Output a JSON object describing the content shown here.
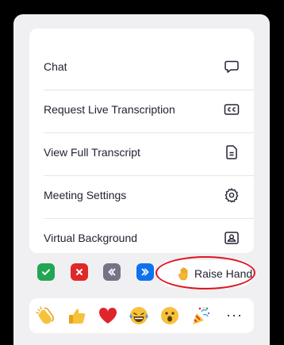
{
  "menu": {
    "items": [
      {
        "label": "Chat",
        "icon": "chat-bubble-icon"
      },
      {
        "label": "Request Live Transcription",
        "icon": "closed-caption-icon"
      },
      {
        "label": "View Full Transcript",
        "icon": "document-icon"
      },
      {
        "label": "Meeting Settings",
        "icon": "gear-icon"
      },
      {
        "label": "Virtual Background",
        "icon": "virtual-background-icon"
      }
    ]
  },
  "status_buttons": [
    {
      "name": "yes",
      "icon": "checkmark-icon",
      "color": "#23a553"
    },
    {
      "name": "no",
      "icon": "x-icon",
      "color": "#e02828"
    },
    {
      "name": "slow-down",
      "icon": "rewind-icon",
      "color": "#747487"
    },
    {
      "name": "speed-up",
      "icon": "fast-forward-icon",
      "color": "#0e72ed"
    }
  ],
  "raise_hand": {
    "label": "Raise Hand",
    "icon": "raised-hand-icon"
  },
  "annotation_color": "#e0141e",
  "reactions": [
    {
      "name": "clapping-hands-emoji"
    },
    {
      "name": "thumbs-up-emoji"
    },
    {
      "name": "red-heart-emoji"
    },
    {
      "name": "tears-of-joy-emoji"
    },
    {
      "name": "open-mouth-emoji"
    },
    {
      "name": "party-popper-emoji"
    }
  ],
  "more_label": "···"
}
